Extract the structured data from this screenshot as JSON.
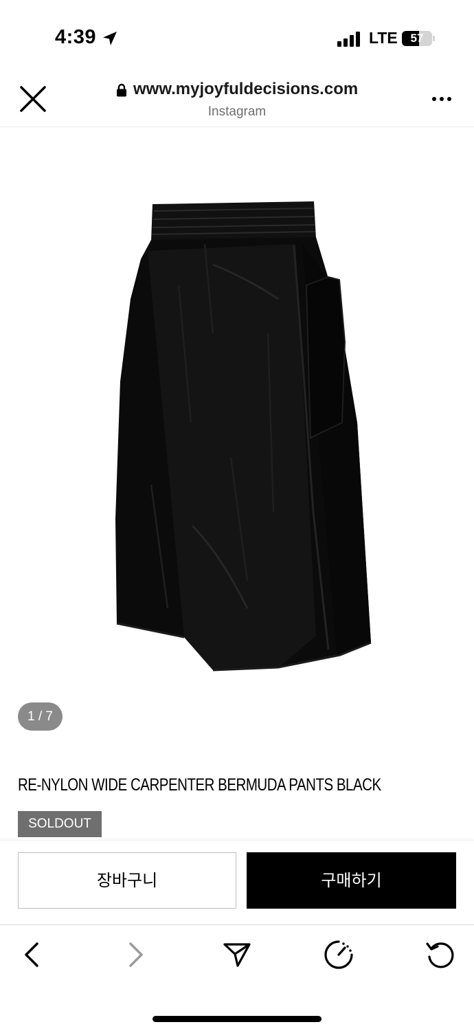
{
  "status_bar": {
    "time": "4:39",
    "network": "LTE",
    "battery_percent": "57",
    "battery_level": 0.57,
    "icons": [
      "location-arrow-icon",
      "cellular-signal-icon",
      "battery-icon"
    ]
  },
  "browser": {
    "url": "www.myjoyfuldecisions.com",
    "source_app": "Instagram",
    "icons": [
      "close-icon",
      "lock-icon",
      "more-icon"
    ]
  },
  "product": {
    "image_counter": "1 / 7",
    "title": "RE-NYLON WIDE CARPENTER BERMUDA PANTS BLACK",
    "badge": "SOLDOUT"
  },
  "actions": {
    "cart_label": "장바구니",
    "buy_label": "구매하기"
  },
  "toolbar": {
    "items": [
      "back-icon",
      "forward-icon",
      "share-icon",
      "speed-icon",
      "reload-icon"
    ]
  },
  "colors": {
    "background": "#ffffff",
    "badge_gray": "#6f6f6f",
    "counter_gray": "#8a8a8a",
    "buy_button": "#000000",
    "text": "#000000"
  }
}
